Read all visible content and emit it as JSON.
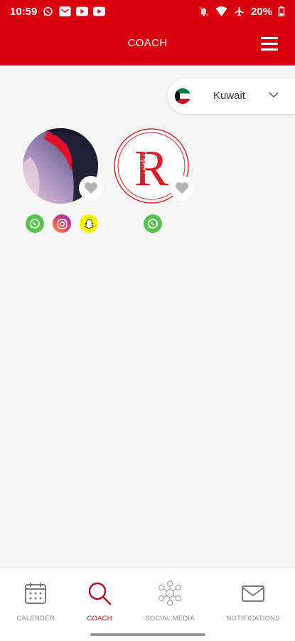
{
  "status_bar": {
    "time": "10:59",
    "battery": "20%",
    "left_icons": [
      "whatsapp-icon",
      "mail-icon",
      "youtube-icon",
      "youtube-icon"
    ],
    "right_icons": [
      "mute-icon",
      "wifi-icon",
      "airplane-icon",
      "battery-icon"
    ]
  },
  "header": {
    "title": "COACH",
    "menu_icon": "hamburger-icon",
    "background": "#d8000e"
  },
  "country_selector": {
    "selected": "Kuwait",
    "flag_icon": "kuwait-flag-icon"
  },
  "coaches": [
    {
      "avatar": "abstract-photo",
      "favorite": false,
      "social": [
        "whatsapp",
        "instagram",
        "snapchat"
      ]
    },
    {
      "avatar": "logo-R",
      "logo_letter": "R",
      "logo_text": "رزنامتي",
      "favorite": false,
      "social": [
        "whatsapp"
      ]
    }
  ],
  "bottom_nav": {
    "items": [
      {
        "label": "CALENDER",
        "icon": "calendar-icon",
        "active": false
      },
      {
        "label": "COACH",
        "icon": "search-icon",
        "active": true
      },
      {
        "label": "SOCIAL MEDIA",
        "icon": "social-network-icon",
        "active": false
      },
      {
        "label": "NOTIFICATIONS",
        "icon": "envelope-icon",
        "active": false
      }
    ]
  },
  "colors": {
    "accent": "#d8000e",
    "active_nav": "#b0101a",
    "inactive_nav": "#8a8a8a",
    "background": "#f7f7f7"
  }
}
